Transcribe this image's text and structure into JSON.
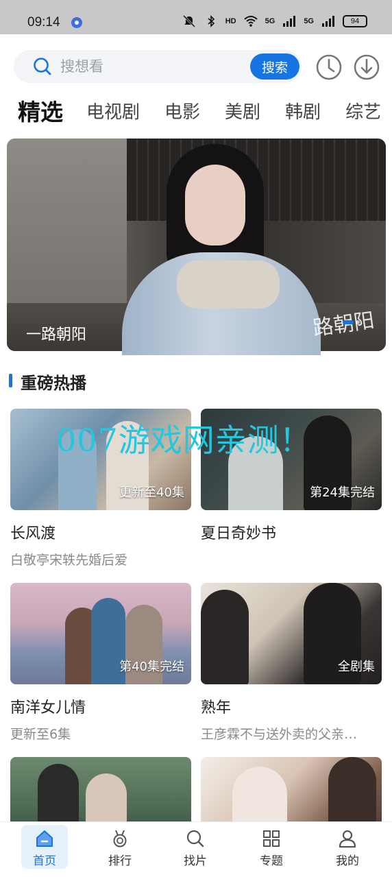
{
  "status_bar": {
    "time": "09:14",
    "network_labels": [
      "HD",
      "5G",
      "5G"
    ],
    "battery": "94"
  },
  "search": {
    "placeholder": "搜想看",
    "button_label": "搜索"
  },
  "header_icons": [
    "history-clock-icon",
    "download-icon"
  ],
  "tabs": [
    {
      "label": "精选",
      "active": true
    },
    {
      "label": "电视剧",
      "active": false
    },
    {
      "label": "电影",
      "active": false
    },
    {
      "label": "美剧",
      "active": false
    },
    {
      "label": "韩剧",
      "active": false
    },
    {
      "label": "综艺",
      "active": false
    }
  ],
  "banner": {
    "title": "一路朝阳",
    "logo_text": "路朝阳"
  },
  "section": {
    "title": "重磅热播"
  },
  "cards": [
    {
      "title": "长风渡",
      "subtitle": "白敬亭宋轶先婚后爱",
      "badge": "更新至40集"
    },
    {
      "title": "夏日奇妙书",
      "subtitle": "",
      "badge": "第24集完结"
    },
    {
      "title": "南洋女儿情",
      "subtitle": "更新至6集",
      "badge": "第40集完结"
    },
    {
      "title": "熟年",
      "subtitle": "王彦霖不与送外卖的父亲…",
      "badge": "全剧集"
    },
    {
      "title": "",
      "subtitle": "",
      "badge": ""
    },
    {
      "title": "",
      "subtitle": "",
      "badge": ""
    }
  ],
  "watermark": "007游戏网亲测！",
  "bottom_nav": [
    {
      "label": "首页",
      "icon": "home-icon",
      "active": true
    },
    {
      "label": "排行",
      "icon": "medal-icon",
      "active": false
    },
    {
      "label": "找片",
      "icon": "search-icon",
      "active": false
    },
    {
      "label": "专题",
      "icon": "grid-icon",
      "active": false
    },
    {
      "label": "我的",
      "icon": "user-icon",
      "active": false
    }
  ],
  "colors": {
    "accent": "#1675e0",
    "watermark": "#22c7e0"
  }
}
